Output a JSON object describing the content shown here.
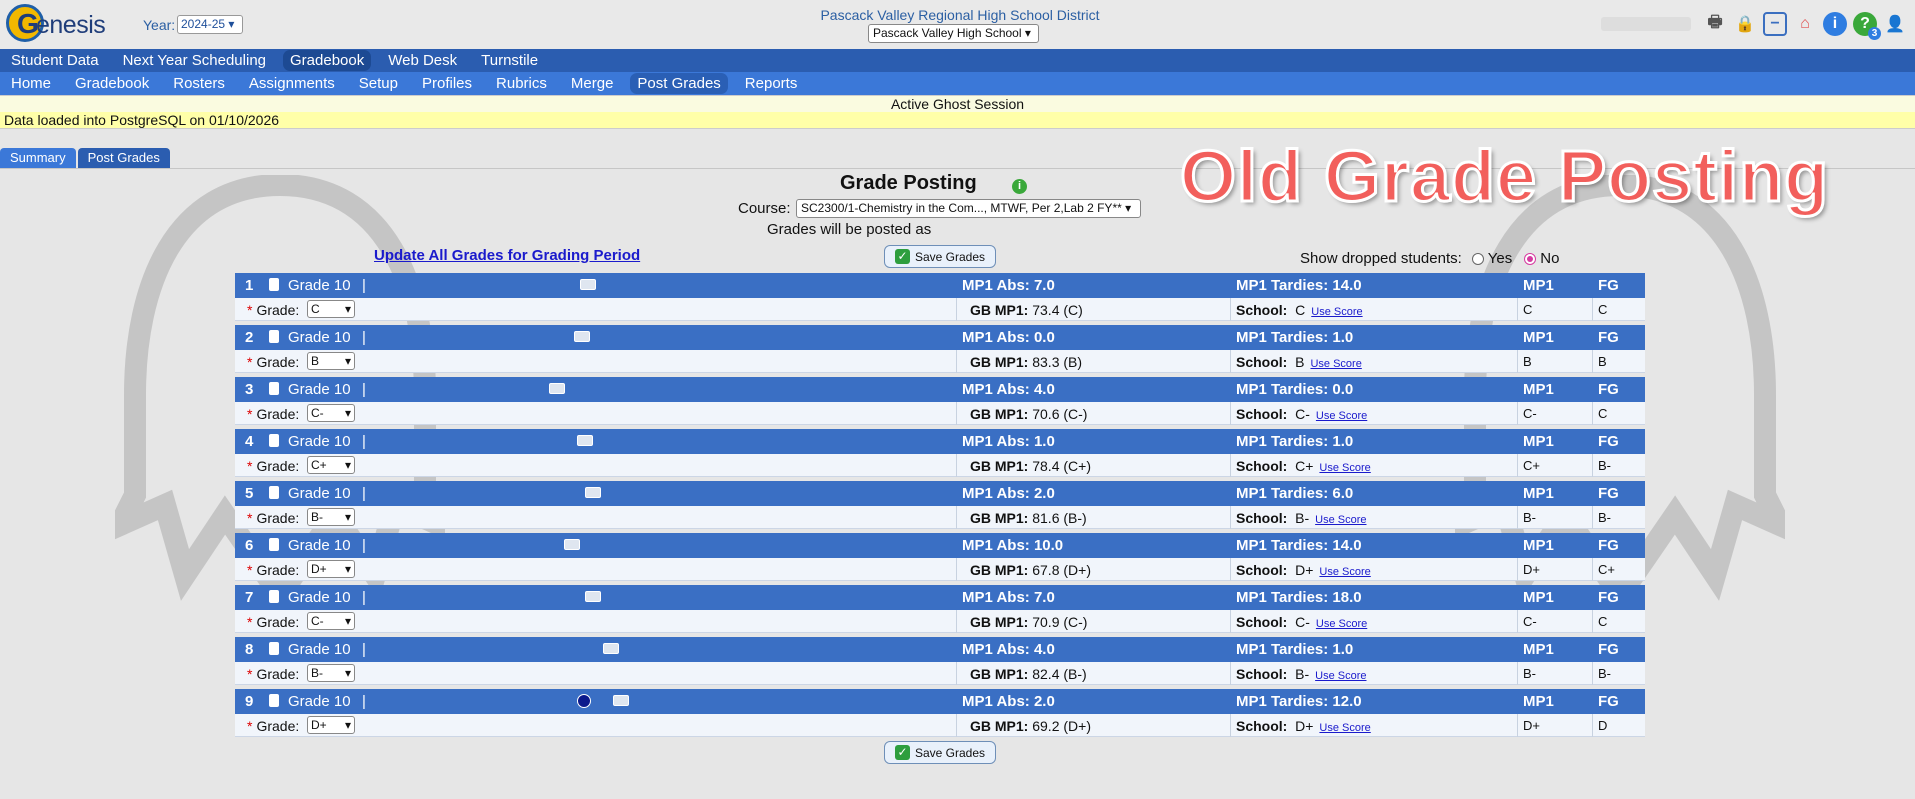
{
  "header": {
    "logo_text": "enesis",
    "logo_letter": "G",
    "year_label": "Year:",
    "year_value": "2024-25",
    "district": "Pascack Valley Regional High School District",
    "school": "Pascack Valley High School",
    "icons": [
      "print-icon",
      "lock-icon",
      "minus-icon",
      "home-icon",
      "info-icon",
      "help-icon",
      "user-icon"
    ],
    "help_badge": "3"
  },
  "menu_main": {
    "items": [
      "Student Data",
      "Next Year Scheduling",
      "Gradebook",
      "Web Desk",
      "Turnstile"
    ],
    "active": "Gradebook"
  },
  "menu_sub": {
    "items": [
      "Home",
      "Gradebook",
      "Rosters",
      "Assignments",
      "Setup",
      "Profiles",
      "Rubrics",
      "Merge",
      "Post Grades",
      "Reports"
    ],
    "active": "Post Grades"
  },
  "banners": {
    "ghost": "Active Ghost Session",
    "data_loaded": "Data loaded into PostgreSQL on 01/10/2026"
  },
  "subtabs": {
    "summary": "Summary",
    "post_grades": "Post Grades"
  },
  "page": {
    "title": "Grade Posting",
    "overlay": "Old Grade Posting",
    "course_label": "Course:",
    "course_value": "SC2300/1-Chemistry in the Com..., MTWF, Per 2,Lab 2 FY**",
    "posted_as": "Grades will be posted as",
    "update_link": "Update All Grades for Grading Period",
    "save_label": "Save Grades",
    "dropped_label": "Show dropped students:",
    "yes": "Yes",
    "no": "No"
  },
  "labels": {
    "grade_level": "Grade 10",
    "bar": "|",
    "grade": "Grade:",
    "required": "*",
    "gb": "GB MP1:",
    "school": "School:",
    "use_score": "Use Score",
    "mp1": "MP1",
    "fg": "FG"
  },
  "students": [
    {
      "num": "1",
      "abs": "MP1 Abs: 7.0",
      "tardies": "MP1 Tardies: 14.0",
      "grade": "C",
      "gb": "73.4 (C)",
      "school": "C",
      "mp1": "C",
      "fg": "C"
    },
    {
      "num": "2",
      "abs": "MP1 Abs: 0.0",
      "tardies": "MP1 Tardies: 1.0",
      "grade": "B",
      "gb": "83.3 (B)",
      "school": "B",
      "mp1": "B",
      "fg": "B"
    },
    {
      "num": "3",
      "abs": "MP1 Abs: 4.0",
      "tardies": "MP1 Tardies: 0.0",
      "grade": "C-",
      "gb": "70.6 (C-)",
      "school": "C-",
      "mp1": "C-",
      "fg": "C"
    },
    {
      "num": "4",
      "abs": "MP1 Abs: 1.0",
      "tardies": "MP1 Tardies: 1.0",
      "grade": "C+",
      "gb": "78.4 (C+)",
      "school": "C+",
      "mp1": "C+",
      "fg": "B-"
    },
    {
      "num": "5",
      "abs": "MP1 Abs: 2.0",
      "tardies": "MP1 Tardies: 6.0",
      "grade": "B-",
      "gb": "81.6 (B-)",
      "school": "B-",
      "mp1": "B-",
      "fg": "B-"
    },
    {
      "num": "6",
      "abs": "MP1 Abs: 10.0",
      "tardies": "MP1 Tardies: 14.0",
      "grade": "D+",
      "gb": "67.8 (D+)",
      "school": "D+",
      "mp1": "D+",
      "fg": "C+"
    },
    {
      "num": "7",
      "abs": "MP1 Abs: 7.0",
      "tardies": "MP1 Tardies: 18.0",
      "grade": "C-",
      "gb": "70.9 (C-)",
      "school": "C-",
      "mp1": "C-",
      "fg": "C"
    },
    {
      "num": "8",
      "abs": "MP1 Abs: 4.0",
      "tardies": "MP1 Tardies: 1.0",
      "grade": "B-",
      "gb": "82.4 (B-)",
      "school": "B-",
      "mp1": "B-",
      "fg": "B-"
    },
    {
      "num": "9",
      "abs": "MP1 Abs: 2.0",
      "tardies": "MP1 Tardies: 12.0",
      "grade": "D+",
      "gb": "69.2 (D+)",
      "school": "D+",
      "mp1": "D+",
      "fg": "D"
    }
  ]
}
